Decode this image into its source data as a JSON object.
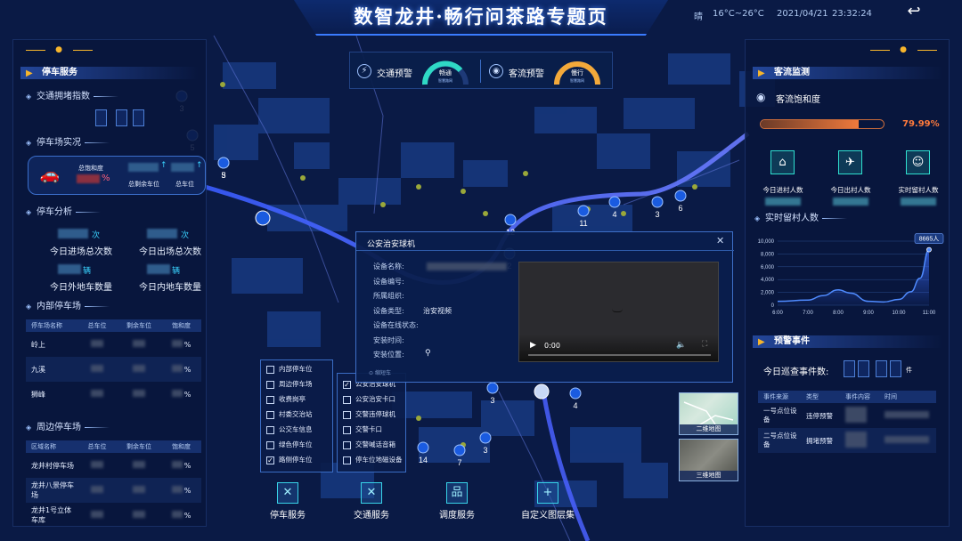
{
  "header": {
    "title": "数智龙井·畅行问茶路专题页",
    "weather": "晴",
    "temperature": "16°C~26°C",
    "date": "2021/04/21",
    "time": "23:32:24",
    "back_icon": "back-arrow-icon"
  },
  "left": {
    "section_title": "停车服务",
    "traffic_index_label": "交通拥堵指数",
    "parking_status_label": "停车场实况",
    "saturation_label": "总饱和度",
    "saturation_unit": "%",
    "remaining_label": "总剩余车位",
    "total_label": "总车位",
    "analysis_label": "停车分析",
    "stats": [
      {
        "unit": "次",
        "label": "今日进场总次数"
      },
      {
        "unit": "次",
        "label": "今日出场总次数"
      },
      {
        "unit": "辆",
        "label": "今日外地车数量"
      },
      {
        "unit": "辆",
        "label": "今日内地车数量"
      }
    ],
    "inner_table": {
      "title": "内部停车场",
      "headers": [
        "停车场名称",
        "总车位",
        "剩余车位",
        "饱和度"
      ],
      "rows": [
        {
          "name": "岭上",
          "pct": "%"
        },
        {
          "name": "九溪",
          "pct": "%"
        },
        {
          "name": "狮峰",
          "pct": "%"
        }
      ]
    },
    "outer_table": {
      "title": "周边停车场",
      "headers": [
        "区域名称",
        "总车位",
        "剩余车位",
        "饱和度"
      ],
      "rows": [
        {
          "name": "龙井村停车场",
          "pct": "%"
        },
        {
          "name": "龙井八景停车场",
          "pct": "%"
        },
        {
          "name": "龙井1号立体车库",
          "pct": "%"
        }
      ]
    }
  },
  "alerts": {
    "traffic_label": "交通预警",
    "traffic_status": "畅通",
    "traffic_sub": "智慧路网",
    "flow_label": "客流预警",
    "flow_status": "慢行",
    "flow_sub": "智慧路网"
  },
  "popup": {
    "title": "公安治安球机",
    "fields": [
      {
        "label": "设备名称:",
        "value": ""
      },
      {
        "label": "设备编号:",
        "value": ""
      },
      {
        "label": "所属组织:",
        "value": ""
      },
      {
        "label": "设备类型:",
        "value": "治安视频"
      },
      {
        "label": "设备在线状态:",
        "value": ""
      },
      {
        "label": "安装时间:",
        "value": ""
      },
      {
        "label": "安装位置:",
        "value": ""
      }
    ],
    "video_time": "0:00",
    "footer_hint": "缩短车"
  },
  "layers_left": {
    "items": [
      {
        "label": "内部停车位",
        "checked": false
      },
      {
        "label": "周边停车场",
        "checked": false
      },
      {
        "label": "收费岗亭",
        "checked": false
      },
      {
        "label": "村委交治站",
        "checked": false
      },
      {
        "label": "公交车信息",
        "checked": false
      },
      {
        "label": "绿色停车位",
        "checked": false
      },
      {
        "label": "路侧停车位",
        "checked": true
      }
    ]
  },
  "layers_right": {
    "items": [
      {
        "label": "公安治安球机",
        "checked": true
      },
      {
        "label": "公安治安卡口",
        "checked": false
      },
      {
        "label": "交警违停球机",
        "checked": false
      },
      {
        "label": "交警卡口",
        "checked": false
      },
      {
        "label": "交警喊话音箱",
        "checked": false
      },
      {
        "label": "停车位地磁设备",
        "checked": false
      }
    ]
  },
  "bottom_buttons": [
    {
      "label": "停车服务",
      "icon": "parking-x-icon",
      "glyph": "✕"
    },
    {
      "label": "交通服务",
      "icon": "traffic-x-icon",
      "glyph": "✕"
    },
    {
      "label": "调度服务",
      "icon": "dispatch-tree-icon",
      "glyph": "品"
    },
    {
      "label": "自定义图层集",
      "icon": "plus-icon",
      "glyph": "+"
    }
  ],
  "map_thumbs": [
    {
      "label": "二维地图"
    },
    {
      "label": "三维地图"
    }
  ],
  "map_markers": [
    {
      "count": "3"
    },
    {
      "count": "5"
    },
    {
      "count": "5"
    },
    {
      "count": "12"
    },
    {
      "count": "11"
    },
    {
      "count": "4"
    },
    {
      "count": "3"
    },
    {
      "count": "6"
    },
    {
      "count": "3"
    },
    {
      "count": "4"
    },
    {
      "count": "3"
    },
    {
      "count": "14"
    },
    {
      "count": "7"
    },
    {
      "count": "3"
    },
    {
      "count": "2"
    }
  ],
  "right": {
    "flow_title": "客流监测",
    "saturation_label": "客流饱和度",
    "saturation_value": 0.7999,
    "saturation_text": "79.99%",
    "kpis": [
      {
        "label": "今日进村人数",
        "icon": "person-enter-icon"
      },
      {
        "label": "今日出村人数",
        "icon": "person-run-icon"
      },
      {
        "label": "实时留村人数",
        "icon": "person-stay-icon"
      }
    ],
    "realtime_label": "实时留村人数",
    "warning_title": "预警事件",
    "patrol_label": "今日巡查事件数:",
    "patrol_unit": "件",
    "event_headers": [
      "事件来源",
      "类型",
      "事件内容",
      "时间"
    ],
    "events": [
      {
        "source": "一号点位设备",
        "type": "违停预警"
      },
      {
        "source": "二号点位设备",
        "type": "拥堵预警"
      }
    ]
  },
  "chart_data": {
    "type": "area",
    "x": [
      "6:00",
      "7:00",
      "8:00",
      "9:00",
      "10:00",
      "11:00"
    ],
    "xvals": [
      6,
      7,
      8,
      9,
      10,
      11
    ],
    "ylim": [
      0,
      10000
    ],
    "yticks": [
      0,
      2000,
      4000,
      6000,
      8000,
      10000
    ],
    "series": [
      {
        "points": [
          [
            6,
            600
          ],
          [
            7,
            800
          ],
          [
            7.5,
            1500
          ],
          [
            8,
            2400
          ],
          [
            8.4,
            1900
          ],
          [
            9,
            600
          ],
          [
            9.5,
            500
          ],
          [
            10,
            900
          ],
          [
            10.4,
            2100
          ],
          [
            10.7,
            4200
          ],
          [
            11,
            8665
          ]
        ]
      }
    ],
    "annotation": "8665人",
    "annotation_value": 8665
  }
}
